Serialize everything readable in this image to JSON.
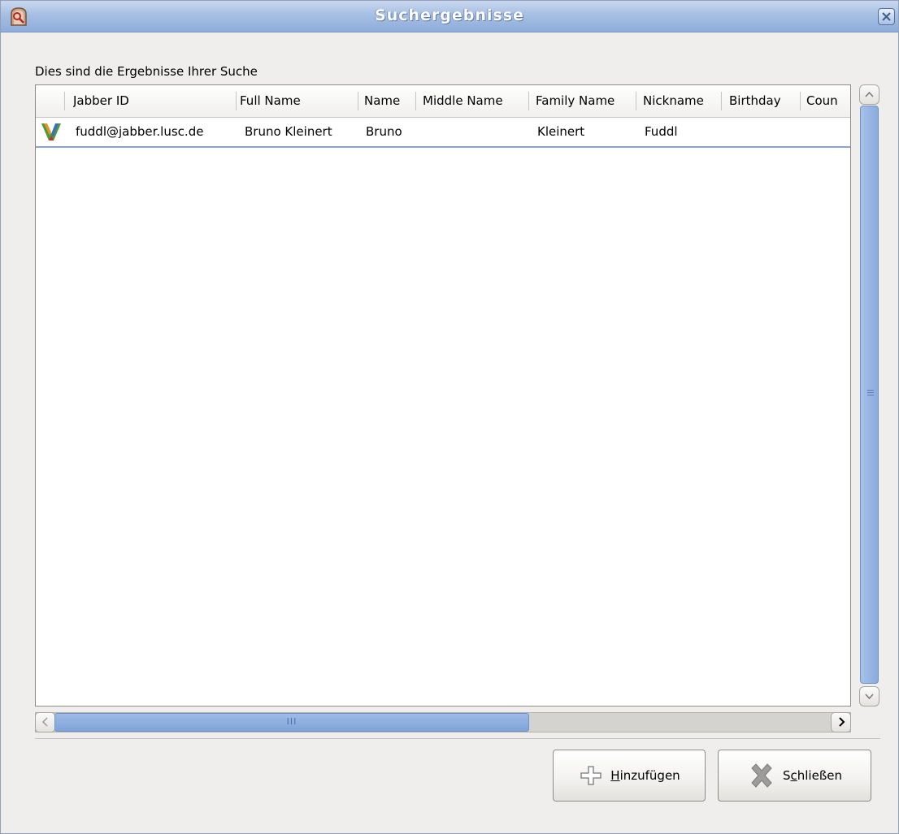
{
  "window": {
    "title": "Suchergebnisse"
  },
  "heading": "Dies sind die Ergebnisse Ihrer Suche",
  "columns": [
    "Jabber ID",
    "Full Name",
    "Name",
    "Middle Name",
    "Family Name",
    "Nickname",
    "Birthday",
    "Coun"
  ],
  "rows": [
    {
      "icon": "jabber-contact-icon",
      "jabber_id": "fuddl@jabber.lusc.de",
      "full_name": "Bruno Kleinert",
      "name": "Bruno",
      "middle_name": "",
      "family_name": "Kleinert",
      "nickname": "Fuddl",
      "birthday": "",
      "country": ""
    }
  ],
  "hscroll_grip": "III",
  "vscroll_grip": "≡",
  "buttons": {
    "add": {
      "pre": "",
      "mnemonic": "H",
      "post": "inzufügen",
      "icon": "plus-icon"
    },
    "close": {
      "pre": "S",
      "mnemonic": "c",
      "post": "hließen",
      "icon": "x-icon"
    }
  },
  "colors": {
    "accent": "#8eaddb",
    "scroll_thumb": "#89abde"
  }
}
